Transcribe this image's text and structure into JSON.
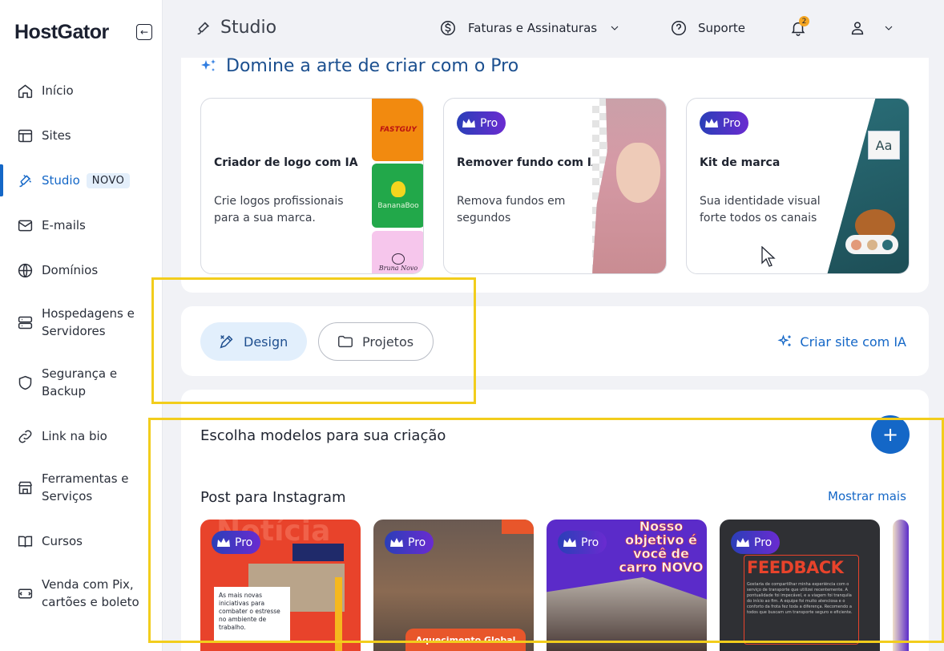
{
  "sidebar": {
    "logo": "HostGator",
    "items": [
      {
        "label": "Início"
      },
      {
        "label": "Sites"
      },
      {
        "label": "Studio",
        "badge": "NOVO"
      },
      {
        "label": "E-mails"
      },
      {
        "label": "Domínios"
      },
      {
        "label": "Hospedagens e Servidores"
      },
      {
        "label": "Segurança e Backup"
      },
      {
        "label": "Link na bio"
      },
      {
        "label": "Ferramentas e Serviços"
      },
      {
        "label": "Cursos"
      },
      {
        "label": "Venda com Pix, cartões e boleto"
      }
    ]
  },
  "topbar": {
    "title": "Studio",
    "billing": "Faturas e Assinaturas",
    "support": "Suporte",
    "notifications": "2"
  },
  "promo": {
    "title": "Domine a arte de criar com o Pro",
    "cards": [
      {
        "name": "Criador de logo com IA",
        "desc": "Crie logos profissionais para a sua marca.",
        "thumbs": [
          "FASTGUY",
          "BananaBoo",
          "Bruna Novo"
        ]
      },
      {
        "name": "Remover fundo com IA",
        "desc": "Remova fundos em segundos",
        "badge": "Pro"
      },
      {
        "name": "Kit de marca",
        "desc": "Sua identidade visual forte todos os canais",
        "badge": "Pro",
        "sample": "Aa"
      }
    ]
  },
  "tabs": {
    "design": "Design",
    "projects": "Projetos",
    "ai_site": "Criar site com IA"
  },
  "templates": {
    "title": "Escolha modelos para sua criação",
    "fab": "+",
    "instagram": {
      "title": "Post para Instagram",
      "show_more": "Mostrar mais",
      "badge": "Pro",
      "cards": [
        {
          "headline": "Notícia",
          "text": "As mais novas iniciativas para combater o estresse no ambiente de trabalho."
        },
        {
          "caption": "Aquecimento Global"
        },
        {
          "headline": "Nosso objetivo é você de carro NOVO"
        },
        {
          "headline": "FEEDBACK",
          "text": "Gostaria de compartilhar minha experiência com o serviço de transporte que utilizei recentemente. A pontualidade foi impecável, e a viagem foi tranquila do início ao fim. A equipe foi muito atenciosa e o conforto da frota fez toda a diferença. Recomendo a todos que buscam um transporte seguro e eficiente."
        }
      ]
    }
  },
  "colors": {
    "accent": "#1467c7",
    "highlight": "#f2cd1c",
    "pro_gradient_start": "#2a3fb8",
    "pro_gradient_end": "#6a2bd0"
  }
}
